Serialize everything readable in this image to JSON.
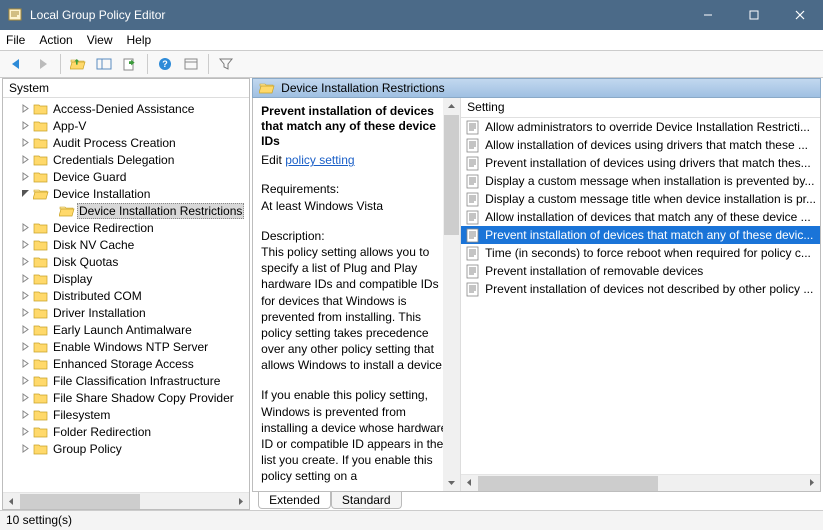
{
  "window": {
    "title": "Local Group Policy Editor"
  },
  "menu": {
    "items": [
      "File",
      "Action",
      "View",
      "Help"
    ]
  },
  "toolbar_icons": [
    "back",
    "forward",
    "up",
    "tree-toggle",
    "export",
    "help",
    "properties",
    "filter"
  ],
  "left": {
    "header": "System",
    "selected": "Device Installation Restrictions",
    "items": [
      {
        "label": "Access-Denied Assistance",
        "indent": 1
      },
      {
        "label": "App-V",
        "indent": 1
      },
      {
        "label": "Audit Process Creation",
        "indent": 1
      },
      {
        "label": "Credentials Delegation",
        "indent": 1
      },
      {
        "label": "Device Guard",
        "indent": 1
      },
      {
        "label": "Device Installation",
        "indent": 1,
        "expanded": true
      },
      {
        "label": "Device Installation Restrictions",
        "indent": 2,
        "selected": true
      },
      {
        "label": "Device Redirection",
        "indent": 1
      },
      {
        "label": "Disk NV Cache",
        "indent": 1
      },
      {
        "label": "Disk Quotas",
        "indent": 1
      },
      {
        "label": "Display",
        "indent": 1
      },
      {
        "label": "Distributed COM",
        "indent": 1
      },
      {
        "label": "Driver Installation",
        "indent": 1
      },
      {
        "label": "Early Launch Antimalware",
        "indent": 1
      },
      {
        "label": "Enable Windows NTP Server",
        "indent": 1
      },
      {
        "label": "Enhanced Storage Access",
        "indent": 1
      },
      {
        "label": "File Classification Infrastructure",
        "indent": 1
      },
      {
        "label": "File Share Shadow Copy Provider",
        "indent": 1
      },
      {
        "label": "Filesystem",
        "indent": 1
      },
      {
        "label": "Folder Redirection",
        "indent": 1
      },
      {
        "label": "Group Policy",
        "indent": 1
      }
    ]
  },
  "right": {
    "header": "Device Installation Restrictions",
    "policy_title": "Prevent installation of devices that match any of these device IDs",
    "edit_label": "Edit",
    "edit_link": "policy setting",
    "req_label": "Requirements:",
    "req_value": "At least Windows Vista",
    "desc_label": "Description:",
    "desc_text": "This policy setting allows you to specify a list of Plug and Play hardware IDs and compatible IDs for devices that Windows is prevented from installing. This policy setting takes precedence over any other policy setting that allows Windows to install a device.",
    "desc_text2": "If you enable this policy setting, Windows is prevented from installing a device whose hardware ID or compatible ID appears in the list you create. If you enable this policy setting on a",
    "settings_header": "Setting",
    "settings": [
      "Allow administrators to override Device Installation Restricti...",
      "Allow installation of devices using drivers that match these ...",
      "Prevent installation of devices using drivers that match thes...",
      "Display a custom message when installation is prevented by...",
      "Display a custom message title when device installation is pr...",
      "Allow installation of devices that match any of these device ...",
      "Prevent installation of devices that match any of these devic...",
      "Time (in seconds) to force reboot when required for policy c...",
      "Prevent installation of removable devices",
      "Prevent installation of devices not described by other policy ..."
    ],
    "selected_setting_index": 6,
    "tabs": {
      "extended": "Extended",
      "standard": "Standard",
      "active": "extended"
    }
  },
  "status": "10 setting(s)"
}
